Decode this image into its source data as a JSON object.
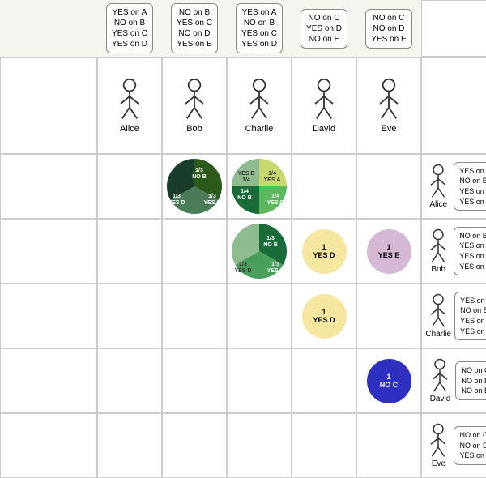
{
  "headers": {
    "alice": [
      "YES on A",
      "NO on B",
      "YES on C",
      "YES on D"
    ],
    "bob": [
      "NO on B",
      "YES on C",
      "NO on D",
      "YES on E"
    ],
    "charlie": [
      "YES on A",
      "NO on B",
      "YES on C",
      "YES on D"
    ],
    "david": [
      "NO on C",
      "YES on D",
      "NO on E"
    ],
    "eve": [
      "NO on C",
      "NO on D",
      "YES on E"
    ]
  },
  "persons": [
    "Alice",
    "Bob",
    "Charlie",
    "David",
    "Eve"
  ],
  "right_labels": {
    "alice": [
      "YES on A",
      "NO on B",
      "YES on C",
      "YES on D"
    ],
    "bob": [
      "NO on B",
      "YES on C",
      "YES on D",
      "YES on E"
    ],
    "charlie": [
      "YES on A",
      "NO on B",
      "YES on C",
      "YES on D"
    ],
    "david": [
      "NO on C",
      "NO on D",
      "NO on E"
    ],
    "eve": [
      "NO on C",
      "NO on D",
      "YES on E"
    ]
  },
  "icons": {
    "person": "person"
  }
}
